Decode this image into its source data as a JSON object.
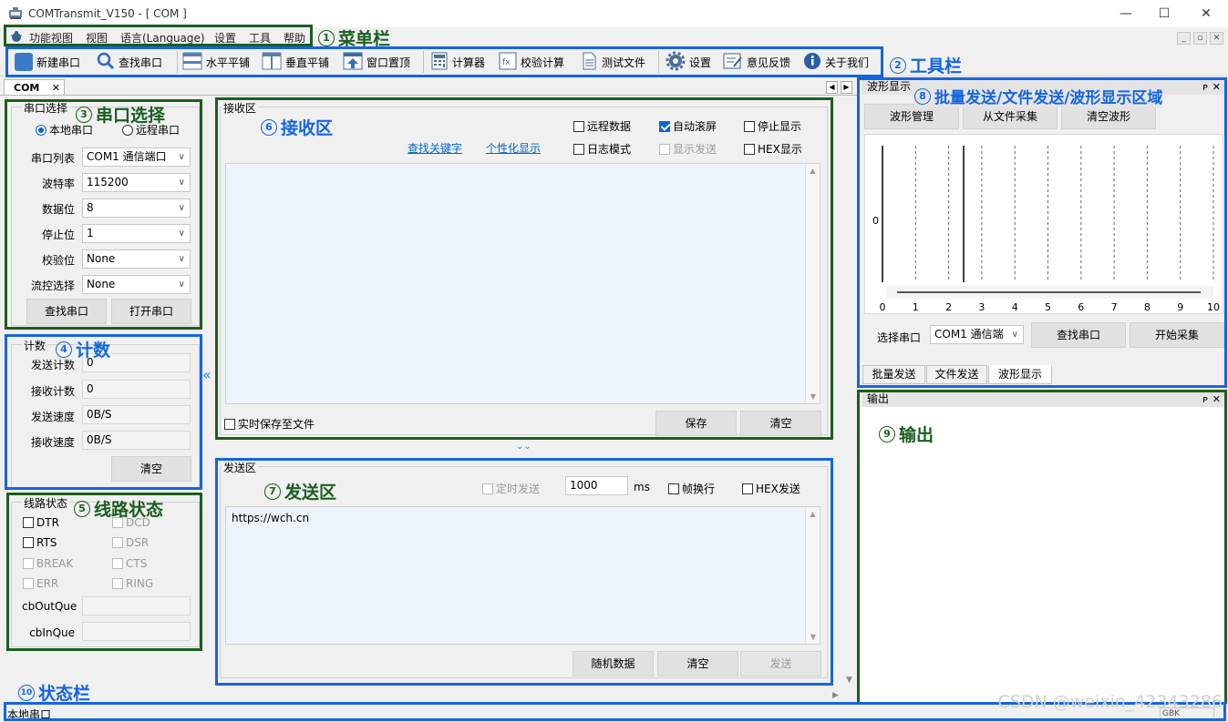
{
  "window": {
    "title": "COMTransmit_V150 - [  COM  ]",
    "min": "—",
    "max": "☐",
    "close": "✕"
  },
  "menu": [
    "功能视图",
    "视图",
    "语言(Language)",
    "设置",
    "工具",
    "帮助"
  ],
  "mdi": {
    "min": "_",
    "restore": "▫",
    "close": "✕"
  },
  "toolbar": [
    {
      "label": "新建串口",
      "icon": "new-port-icon",
      "color": "#3c7ac8"
    },
    {
      "label": "查找串口",
      "icon": "search-icon",
      "color": "#2e6bb8"
    },
    {
      "label": "水平平铺",
      "icon": "tile-horizontal-icon",
      "color": "#5a7fae"
    },
    {
      "label": "垂直平铺",
      "icon": "tile-vertical-icon",
      "color": "#5a7fae"
    },
    {
      "label": "窗口置顶",
      "icon": "pin-top-icon",
      "color": "#3c6da8"
    },
    {
      "label": "计算器",
      "icon": "calculator-icon",
      "color": "#4a6d90"
    },
    {
      "label": "校验计算",
      "icon": "checksum-icon",
      "color": "#4a6d90"
    },
    {
      "label": "测试文件",
      "icon": "test-file-icon",
      "color": "#506c8c"
    },
    {
      "label": "设置",
      "icon": "gear-icon",
      "color": "#4b6e99"
    },
    {
      "label": "意见反馈",
      "icon": "feedback-icon",
      "color": "#3d5f8f"
    },
    {
      "label": "关于我们",
      "icon": "info-icon",
      "color": "#2d5ca8"
    }
  ],
  "doc_tab": {
    "label": "COM",
    "close": "✕",
    "nav_left": "◀",
    "nav_right": "▶"
  },
  "port": {
    "group_title": "串口选择",
    "local": "本地串口",
    "remote": "远程串口",
    "rows": [
      {
        "label": "串口列表",
        "value": "COM1  通信端口"
      },
      {
        "label": "波特率",
        "value": "115200"
      },
      {
        "label": "数据位",
        "value": "8"
      },
      {
        "label": "停止位",
        "value": "1"
      },
      {
        "label": "校验位",
        "value": "None"
      },
      {
        "label": "流控选择",
        "value": "None"
      }
    ],
    "find_btn": "查找串口",
    "open_btn": "打开串口"
  },
  "count": {
    "group_title": "计数",
    "rows": [
      {
        "label": "发送计数",
        "value": "0"
      },
      {
        "label": "接收计数",
        "value": "0"
      },
      {
        "label": "发送速度",
        "value": "0B/S"
      },
      {
        "label": "接收速度",
        "value": "0B/S"
      }
    ],
    "clear_btn": "清空",
    "collapse": "«"
  },
  "line": {
    "group_title": "线路状态",
    "checks": [
      "DTR",
      "DCD",
      "RTS",
      "DSR",
      "BREAK",
      "CTS",
      "ERR",
      "RING"
    ],
    "out_label": "cbOutQue",
    "in_label": "cbInQue"
  },
  "recv": {
    "group_title": "接收区",
    "opts": [
      "远程数据",
      "自动滚屏",
      "停止显示",
      "日志模式",
      "显示发送",
      "HEX显示"
    ],
    "link1": "查找关键字",
    "link2": "个性化显示",
    "save_file": "实时保存至文件",
    "save_btn": "保存",
    "clear_btn": "清空",
    "split": "⌄⌄"
  },
  "send": {
    "group_title": "发送区",
    "timer": "定时发送",
    "interval": "1000",
    "ms": "ms",
    "newline": "帧换行",
    "hex": "HEX发送",
    "content": "https://wch.cn",
    "random_btn": "随机数据",
    "clear_btn": "清空",
    "send_btn": "发送"
  },
  "wave": {
    "pane_title": "波形显示",
    "pin": "ᴘ",
    "close": "✕",
    "btn1": "波形管理",
    "btn2": "从文件采集",
    "btn3": "清空波形",
    "y_label": "0",
    "x_ticks": [
      "0",
      "1",
      "2",
      "3",
      "4",
      "5",
      "6",
      "7",
      "8",
      "9",
      "10"
    ],
    "port_label": "选择串口",
    "port_value": "COM1  通信端",
    "find_btn": "查找串口",
    "start_btn": "开始采集",
    "tabs": [
      "批量发送",
      "文件发送",
      "波形显示"
    ]
  },
  "output": {
    "pane_title": "输出",
    "pin": "ᴘ",
    "close": "✕"
  },
  "status": {
    "left": "本地串口",
    "encoding": "GBK"
  },
  "annotations": [
    {
      "num": "1",
      "text": "菜单栏"
    },
    {
      "num": "2",
      "text": "工具栏"
    },
    {
      "num": "3",
      "text": "串口选择"
    },
    {
      "num": "4",
      "text": "计数"
    },
    {
      "num": "5",
      "text": "线路状态"
    },
    {
      "num": "6",
      "text": "接收区"
    },
    {
      "num": "7",
      "text": "发送区"
    },
    {
      "num": "8",
      "text": "批量发送/文件发送/波形显示区域"
    },
    {
      "num": "9",
      "text": "输出"
    },
    {
      "num": "10",
      "text": "状态栏"
    }
  ],
  "watermark": "CSDN @weixin_42343286",
  "colors": {
    "ann_green": "#1b5e20",
    "ann_blue": "#1565e0",
    "recv_bg": "#eef4fc",
    "accent": "#0a64d8"
  }
}
